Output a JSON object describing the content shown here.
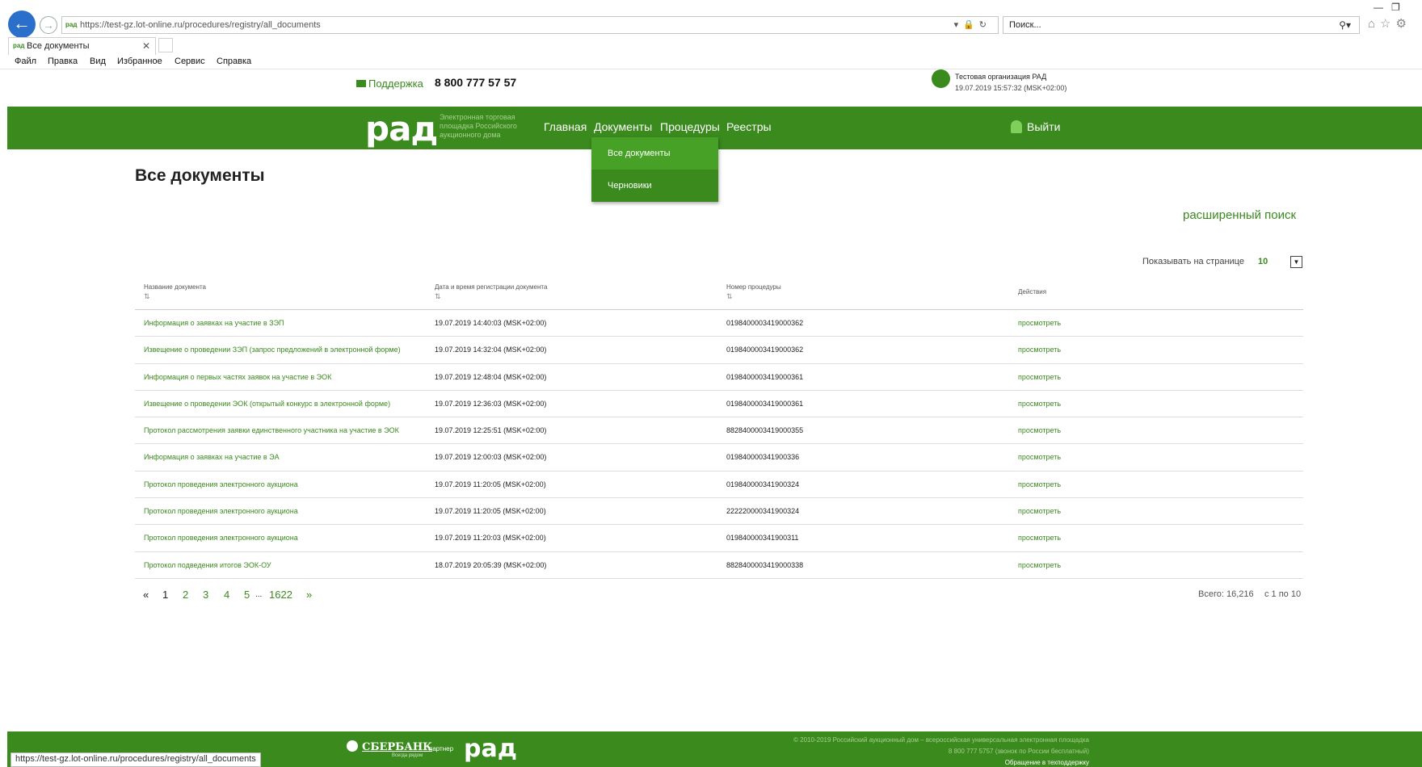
{
  "browser": {
    "url": "https://test-gz.lot-online.ru/procedures/registry/all_documents",
    "search_placeholder": "Поиск...",
    "tab_title": "Все документы",
    "favicon_text": "рад",
    "menu": [
      "Файл",
      "Правка",
      "Вид",
      "Избранное",
      "Сервис",
      "Справка"
    ],
    "status_url": "https://test-gz.lot-online.ru/procedures/registry/all_documents"
  },
  "header": {
    "support_label": "Поддержка",
    "phone": "8 800 777 57 57",
    "org_name": "Тестовая организация РАД",
    "org_time": "19.07.2019 15:57:32 (MSK+02:00)"
  },
  "navbar": {
    "logo": "рад",
    "logo_subtitle": "Электронная торговая площадка Российского аукционного дома",
    "items": [
      "Главная",
      "Документы",
      "Процедуры",
      "Реестры"
    ],
    "logout": "Выйти",
    "dropdown": [
      "Все документы",
      "Черновики"
    ]
  },
  "page": {
    "title": "Все документы",
    "advanced_search": "расширенный поиск",
    "per_page_label": "Показывать на странице",
    "per_page_value": "10"
  },
  "table": {
    "columns": [
      "Название документа",
      "Дата и время регистрации документа",
      "Номер процедуры",
      "Действия"
    ],
    "rows": [
      {
        "name": "Информация о заявках на участие в ЗЭП",
        "date": "19.07.2019 14:40:03 (MSK+02:00)",
        "number": "0198400003419000362",
        "action": "просмотреть"
      },
      {
        "name": "Извещение о проведении ЗЭП (запрос предложений в электронной форме)",
        "date": "19.07.2019 14:32:04 (MSK+02:00)",
        "number": "0198400003419000362",
        "action": "просмотреть"
      },
      {
        "name": "Информация о первых частях заявок на участие в ЭОК",
        "date": "19.07.2019 12:48:04 (MSK+02:00)",
        "number": "0198400003419000361",
        "action": "просмотреть"
      },
      {
        "name": "Извещение о проведении ЭОК (открытый конкурс в электронной форме)",
        "date": "19.07.2019 12:36:03 (MSK+02:00)",
        "number": "0198400003419000361",
        "action": "просмотреть"
      },
      {
        "name": "Протокол рассмотрения заявки единственного участника на участие в ЭОК",
        "date": "19.07.2019 12:25:51 (MSK+02:00)",
        "number": "8828400003419000355",
        "action": "просмотреть"
      },
      {
        "name": "Информация о заявках на участие в ЭА",
        "date": "19.07.2019 12:00:03 (MSK+02:00)",
        "number": "019840000341900336",
        "action": "просмотреть"
      },
      {
        "name": "Протокол проведения электронного аукциона",
        "date": "19.07.2019 11:20:05 (MSK+02:00)",
        "number": "019840000341900324",
        "action": "просмотреть"
      },
      {
        "name": "Протокол проведения электронного аукциона",
        "date": "19.07.2019 11:20:05 (MSK+02:00)",
        "number": "222220000341900324",
        "action": "просмотреть"
      },
      {
        "name": "Протокол проведения электронного аукциона",
        "date": "19.07.2019 11:20:03 (MSK+02:00)",
        "number": "019840000341900311",
        "action": "просмотреть"
      },
      {
        "name": "Протокол подведения итогов ЭОК-ОУ",
        "date": "18.07.2019 20:05:39 (MSK+02:00)",
        "number": "8828400003419000338",
        "action": "просмотреть"
      }
    ]
  },
  "pagination": {
    "prev": "«",
    "pages": [
      "1",
      "2",
      "3",
      "4",
      "5"
    ],
    "ellipsis": "...",
    "last": "1622",
    "next": "»",
    "current": "1",
    "total": "Всего: 16,216",
    "range": "с 1 по 10"
  },
  "footer": {
    "sber": "СБЕРБАНК",
    "sber_sub": "Всегда рядом",
    "partner": "партнер",
    "logo": "рад",
    "copyright": "© 2010-2019 Российский аукционный дом – всероссийская универсальная электронная площадка",
    "phone_line": "8 800 777 5757 (звонок по России бесплатный)",
    "support_link": "Обращение в техподдержку"
  },
  "colors": {
    "brand_green": "#3a8a1e",
    "active_green": "#46a126"
  }
}
